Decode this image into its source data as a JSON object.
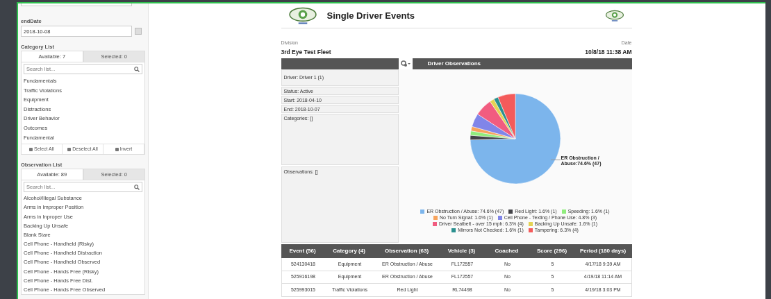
{
  "sidebar": {
    "end_date": {
      "label": "endDate",
      "value": "2018-10-08"
    },
    "category_list": {
      "label": "Category List",
      "tabs": [
        {
          "label": "Available: 7",
          "selected": true
        },
        {
          "label": "Selected: 0",
          "selected": false
        }
      ],
      "search": {
        "placeholder": "Search list..."
      },
      "items": [
        "Fundamentals",
        "Traffic Violations",
        "Equipment",
        "Distractions",
        "Driver Behavior",
        "Outcomes",
        "Fundamental"
      ],
      "actions": [
        "Select All",
        "Deselect All",
        "Invert"
      ]
    },
    "observation_list": {
      "label": "Observation List",
      "tabs": [
        {
          "label": "Available: 89",
          "selected": true
        },
        {
          "label": "Selected: 0",
          "selected": false
        }
      ],
      "search": {
        "placeholder": "Search list..."
      },
      "items": [
        "Alcohol/Illegal Substance",
        "Arms in Improper Position",
        "Arms in Inproper Use",
        "Backing Up Unsafe",
        "Blank Stare",
        "Cell Phone - Handheld (Risky)",
        "Cell Phone - Handheld Distraction",
        "Cell Phone - Handheld Observed",
        "Cell Phone - Hands Free (Risky)",
        "Cell Phone - Hands Free Dist.",
        "Cell Phone - Hands Free Observed"
      ]
    }
  },
  "report": {
    "title": "Single Driver Events",
    "division": {
      "label": "Division",
      "value": "3rd Eye Test Fleet"
    },
    "date": {
      "label": "Date",
      "value": "10/8/18 11:38 AM"
    },
    "panel": {
      "details": [
        "Driver: Driver 1 (1)",
        "Status: Active",
        "Start: 2018-04-10",
        "End: 2018-10-07",
        "Categories: []",
        "Observations: []"
      ],
      "pie_label": "ER Obstruction / Abuse:74.6% (47)",
      "slices": [
        {
          "color": "#7cb5ec"
        },
        {
          "color": "#434348"
        },
        {
          "color": "#90ed7d"
        },
        {
          "color": "#f7a35c"
        },
        {
          "color": "#8085e9"
        },
        {
          "color": "#f15c80"
        },
        {
          "color": "#e4d354"
        },
        {
          "color": "#2b908f"
        },
        {
          "color": "#f45b5b"
        }
      ],
      "chart_data": {
        "type": "pie",
        "title": "Driver Observations",
        "categories": [
          "ER Obstruction / Abuse: 74.6% (47)",
          "Red Light: 1.6% (1)",
          "Speeding: 1.6% (1)",
          "No Turn Signal: 1.6% (1)",
          "Cell Phone - Texting / Phone Use: 4.8% (3)",
          "Driver Seatbelt - over 15 mph: 6.3% (4)",
          "Backing Up Unsafe: 1.6% (1)",
          "Mirrors Not Checked: 1.6% (1)",
          "Tampering: 6.3% (4)"
        ],
        "values": [
          74.6,
          1.6,
          1.6,
          1.6,
          4.8,
          6.3,
          1.6,
          1.6,
          6.3
        ]
      }
    },
    "table": {
      "columns": [
        "Event (56)",
        "Category (4)",
        "Observation (63)",
        "Vehicle (3)",
        "Coached",
        "Score (296)",
        "Period (180 days)"
      ],
      "rows": [
        [
          "524130418",
          "Equipment",
          "ER Obstruction / Abuse",
          "FL172557",
          "No",
          "5",
          "4/17/18 9:39 AM"
        ],
        [
          "525916198",
          "Equipment",
          "ER Obstruction / Abuse",
          "FL172557",
          "No",
          "5",
          "4/19/18 11:14 AM"
        ],
        [
          "525993015",
          "Traffic Violations",
          "Red Light",
          "RL74498",
          "No",
          "5",
          "4/19/18 3:03 PM"
        ]
      ]
    }
  }
}
